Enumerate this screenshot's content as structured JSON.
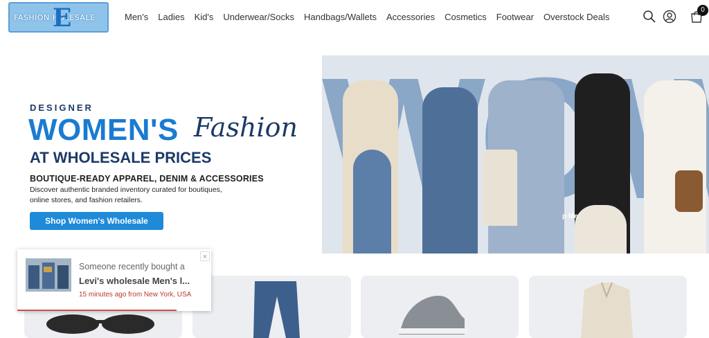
{
  "header": {
    "logo_text": "FASHION    HOLESALE",
    "logo_letter": "E",
    "nav": [
      "Men's",
      "Ladies",
      "Kid's",
      "Underwear/Socks",
      "Handbags/Wallets",
      "Accessories",
      "Cosmetics",
      "Footwear",
      "Overstock Deals"
    ],
    "icons": [
      "search-icon",
      "account-icon",
      "cart-icon"
    ],
    "cart_count": "0"
  },
  "hero": {
    "designer": "DESIGNER",
    "womens": "WOMEN'S",
    "fashion": "Fashion",
    "at_wholesale": "AT WHOLESALE PRICES",
    "boutique": "BOUTIQUE-READY APPAREL, DENIM & ACCESSORIES",
    "discover": "Discover authentic branded inventory curated for boutiques, online stores, and fashion retailers.",
    "cta": "Shop Women's Wholesale",
    "image_word": "WOW",
    "image_label": "p Me"
  },
  "popup": {
    "line1": "Someone recently bought a",
    "line2": "Levi's wholesale Men's l...",
    "line3": "15 minutes ago from New York, USA",
    "close": "×"
  },
  "colors": {
    "accent": "#1f8ad8",
    "navy": "#1b3a66",
    "brand_blue": "#1a7bd1",
    "popup_red": "#b83a2a"
  }
}
